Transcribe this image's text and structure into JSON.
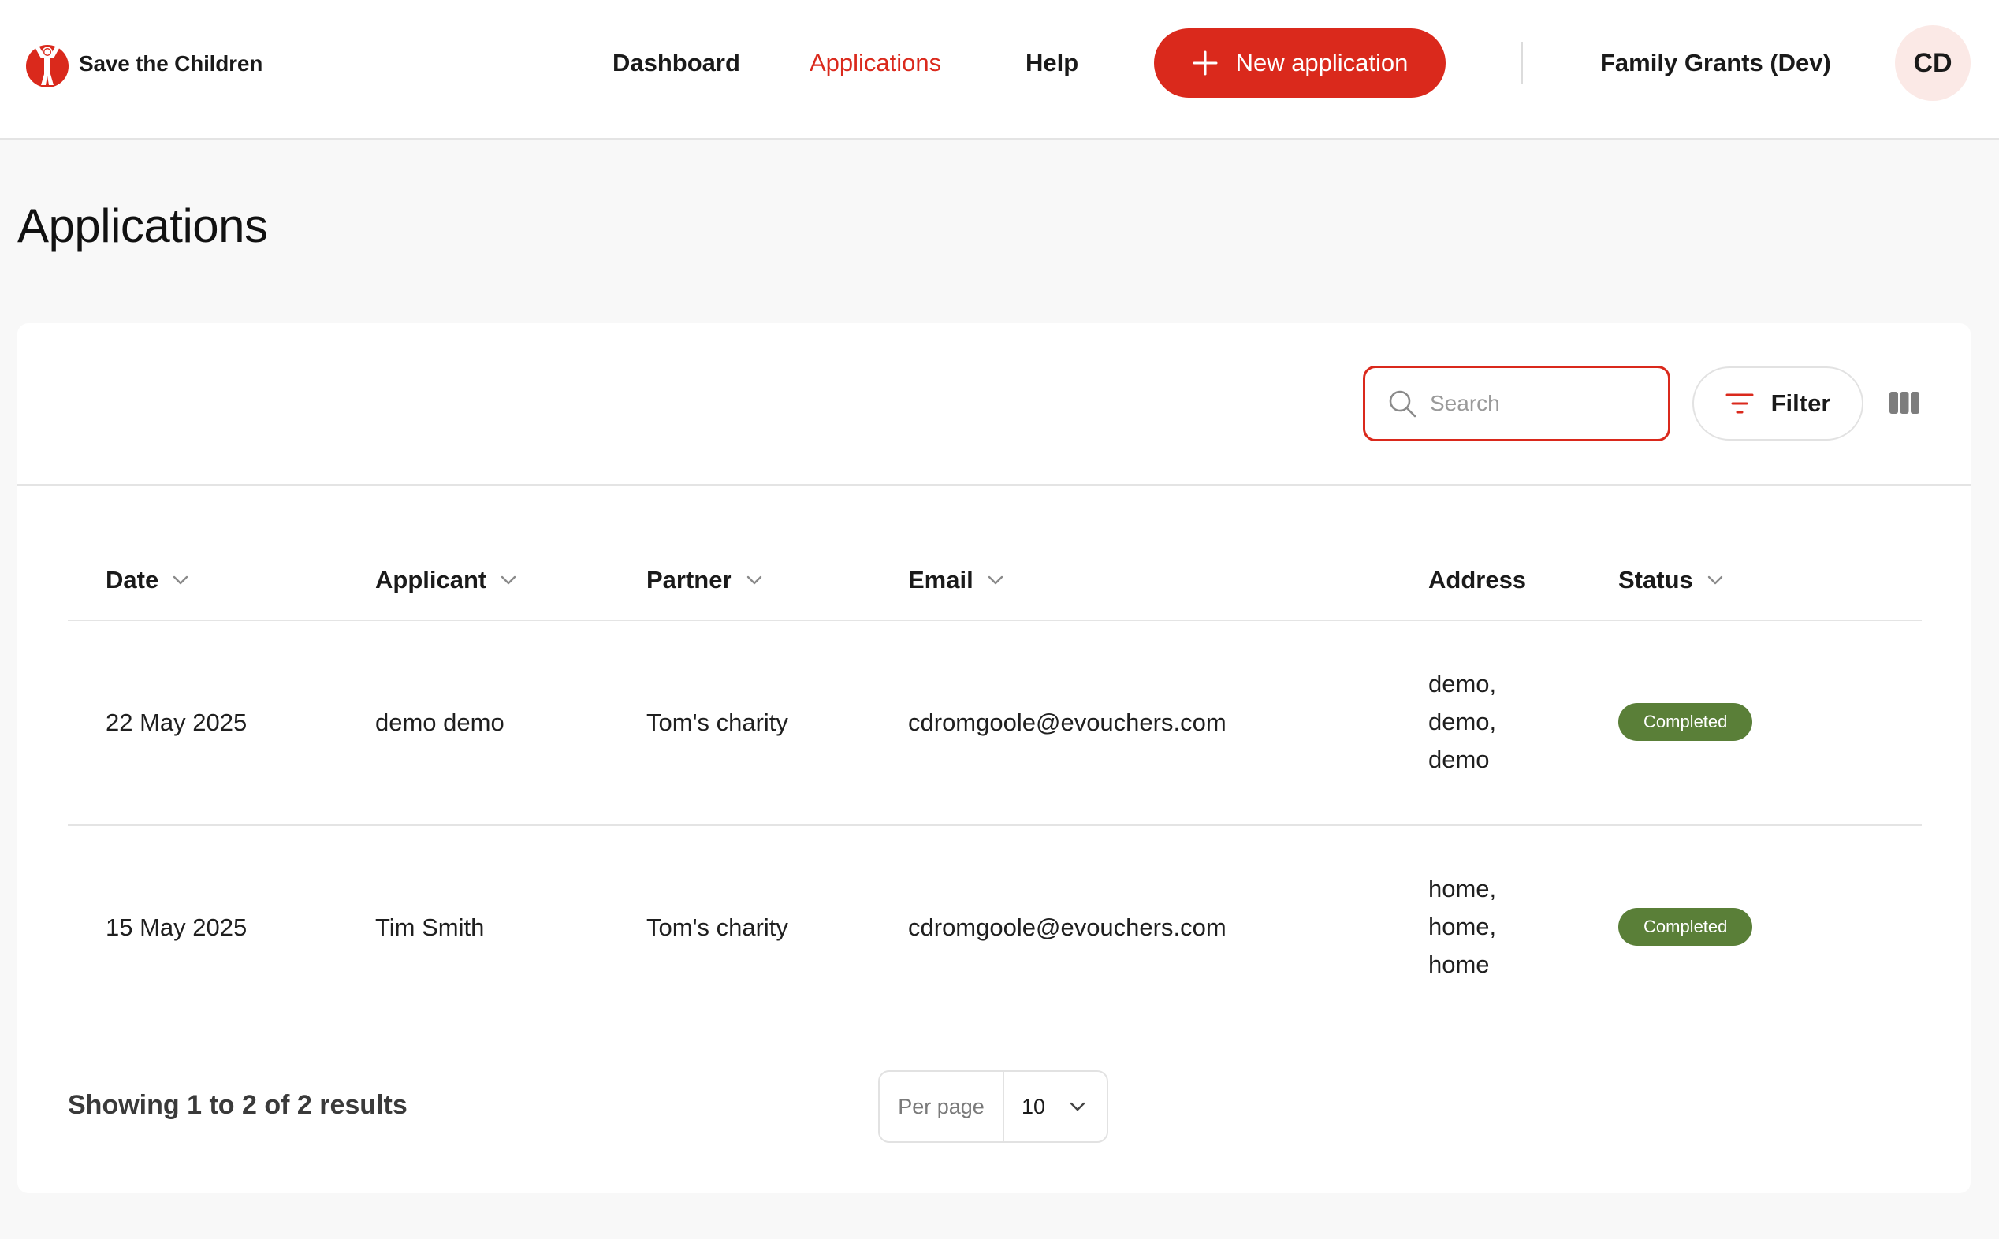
{
  "header": {
    "logo_text": "Save the Children",
    "nav": {
      "dashboard": "Dashboard",
      "applications": "Applications",
      "help": "Help"
    },
    "new_application_label": "New application",
    "org_name": "Family Grants (Dev)",
    "avatar_initials": "CD"
  },
  "page": {
    "title": "Applications"
  },
  "toolbar": {
    "search_placeholder": "Search",
    "filter_label": "Filter"
  },
  "table": {
    "columns": {
      "date": "Date",
      "applicant": "Applicant",
      "partner": "Partner",
      "email": "Email",
      "address": "Address",
      "status": "Status"
    },
    "rows": [
      {
        "date": "22 May 2025",
        "applicant": "demo demo",
        "partner": "Tom's charity",
        "email": "cdromgoole@evouchers.com",
        "address": [
          "demo,",
          "demo,",
          "demo"
        ],
        "status": "Completed"
      },
      {
        "date": "15 May 2025",
        "applicant": "Tim Smith",
        "partner": "Tom's charity",
        "email": "cdromgoole@evouchers.com",
        "address": [
          "home,",
          "home,",
          "home"
        ],
        "status": "Completed"
      }
    ]
  },
  "footer": {
    "results_text": "Showing 1 to 2 of 2 results",
    "per_page_label": "Per page",
    "per_page_value": "10"
  },
  "colors": {
    "accent": "#da291c",
    "status_completed": "#5a7f38",
    "avatar_bg": "#fbe9e6"
  }
}
